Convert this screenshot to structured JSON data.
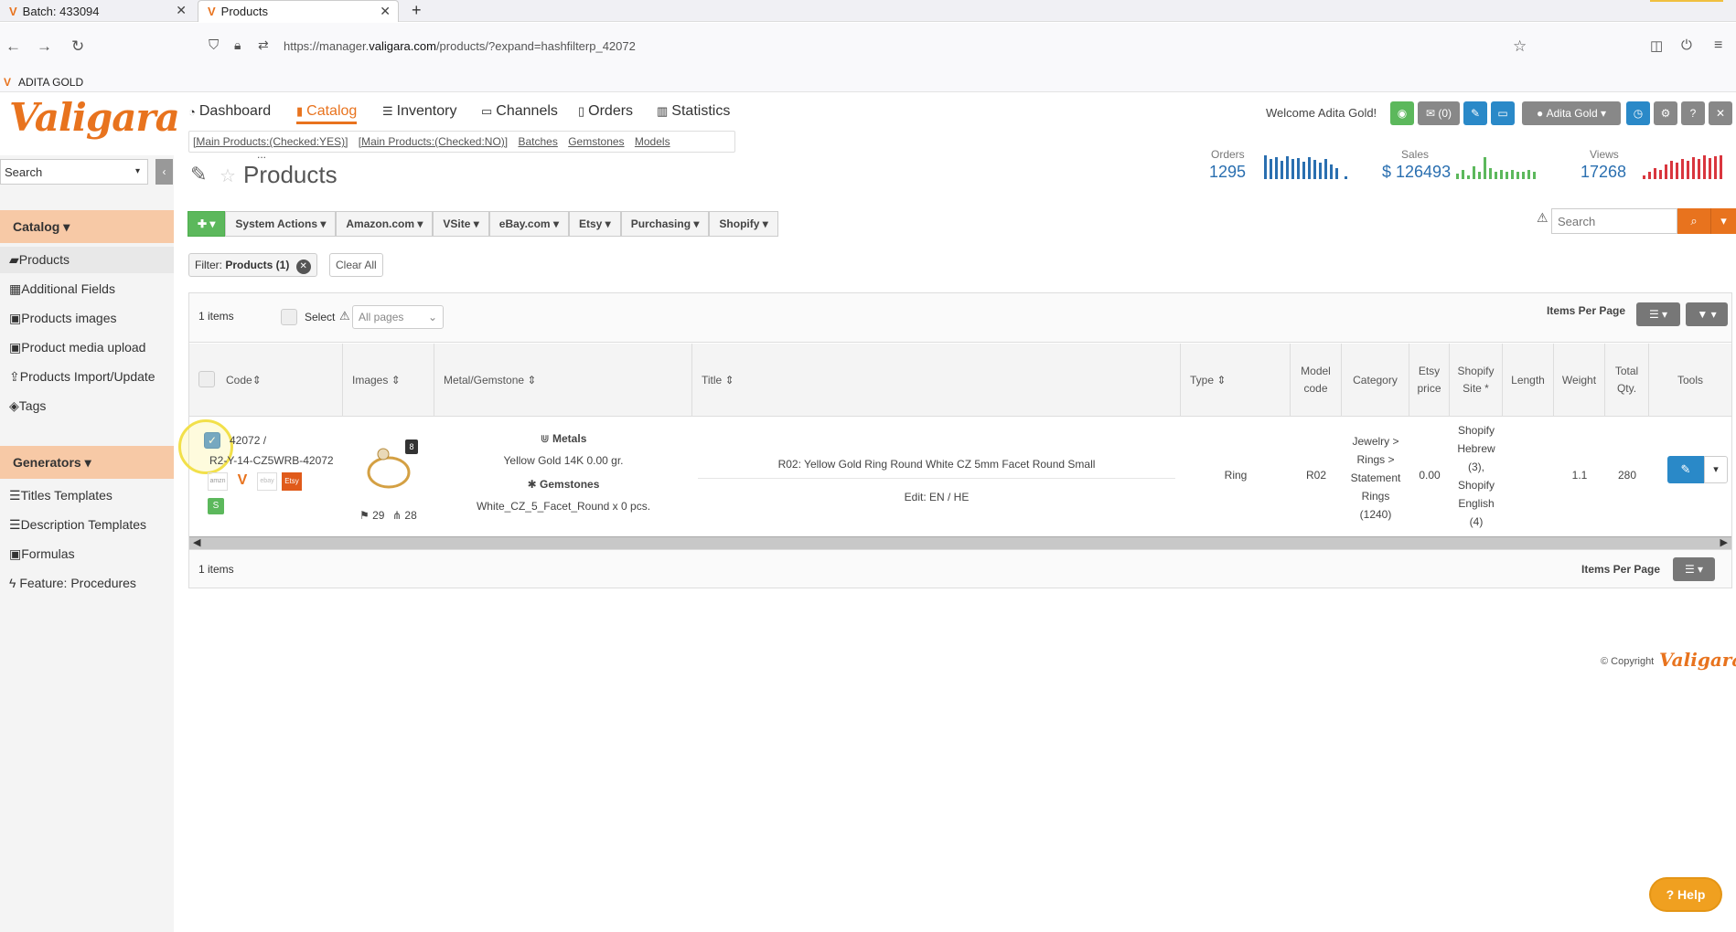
{
  "browser": {
    "tabs": [
      {
        "title": "Batch: 433094"
      },
      {
        "title": "Products"
      }
    ],
    "url_prefix": "https://manager.",
    "url_domain": "valigara.com",
    "url_suffix": "/products/?expand=hashfilterp_42072",
    "bookmark": "ADITA GOLD"
  },
  "header": {
    "logo": "Valigara",
    "nav": [
      "Dashboard",
      "Catalog",
      "Inventory",
      "Channels",
      "Orders",
      "Statistics"
    ],
    "sublinks": [
      "[Main Products:(Checked:YES)]",
      "[Main Products:(Checked:NO)]",
      "Batches",
      "Gemstones",
      "Models",
      "..."
    ],
    "welcome_prefix": "Welcome",
    "welcome_user": "Adita Gold!",
    "messages": "(0)",
    "user_button": "Adita Gold"
  },
  "sidebar": {
    "search_placeholder": "Search",
    "catalog_head": "Catalog",
    "catalog_items": [
      "Products",
      "Additional Fields",
      "Products images",
      "Product media upload",
      "Products Import/Update",
      "Tags"
    ],
    "generators_head": "Generators",
    "generator_items": [
      "Titles Templates",
      "Description Templates",
      "Formulas",
      "Feature: Procedures"
    ]
  },
  "page": {
    "title": "Products",
    "stats": [
      {
        "label": "Orders",
        "value": "1295"
      },
      {
        "label": "Sales",
        "value": "$ 126493"
      },
      {
        "label": "Views",
        "value": "17268"
      }
    ],
    "actions": [
      "System Actions",
      "Amazon.com",
      "VSite",
      "eBay.com",
      "Etsy",
      "Purchasing",
      "Shopify"
    ],
    "filter_label": "Filter:",
    "filter_value": "Products (1)",
    "clear_all": "Clear All",
    "search_placeholder": "Search"
  },
  "table": {
    "items_count": "1 items",
    "select_label": "Select",
    "pages_option": "All pages",
    "items_per_page": "Items Per Page",
    "columns": [
      "Code",
      "Images",
      "Metal/Gemstone",
      "Title",
      "Type",
      "Model code",
      "Category",
      "Etsy price",
      "Shopify Site *",
      "Length",
      "Weight",
      "Total Qty.",
      "Tools"
    ],
    "row": {
      "code_line1": "42072 /",
      "code_line2": "R2-Y-14-CZ5WRB-42072",
      "image_count": "8",
      "flag_count": "29",
      "tree_count": "28",
      "metals_head": "Metals",
      "metals_value": "Yellow Gold 14K 0.00 gr.",
      "gems_head": "Gemstones",
      "gems_value": "White_CZ_5_Facet_Round x 0 pcs.",
      "title": "R02: Yellow Gold Ring Round White CZ 5mm Facet Round Small",
      "edit_links": "Edit: EN / HE",
      "type": "Ring",
      "model_code": "R02",
      "category": [
        "Jewelry >",
        "Rings >",
        "Statement",
        "Rings",
        "(1240)"
      ],
      "etsy_price": "0.00",
      "shopify": [
        "Shopify",
        "Hebrew",
        "(3),",
        "Shopify",
        "English",
        "(4)"
      ],
      "weight": "1.1",
      "total_qty": "280",
      "etsy_badge": "Etsy",
      "ebay_badge": "ebay"
    }
  },
  "footer": {
    "copyright": "© Copyright",
    "brand": "Valigara",
    "help": "Help"
  },
  "colors": {
    "accent": "#e8731e",
    "link": "#2a6fb0",
    "green": "#5cb85c",
    "blue_btn": "#2a89c8"
  }
}
